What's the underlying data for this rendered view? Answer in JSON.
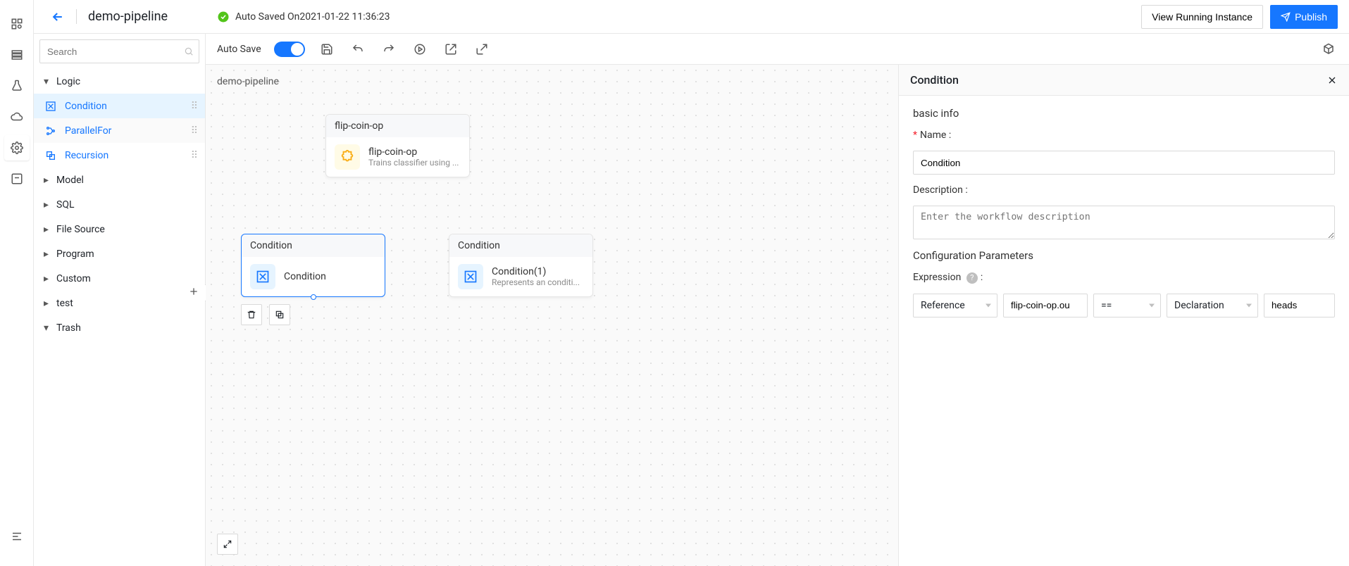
{
  "header": {
    "title": "demo-pipeline",
    "auto_saved_prefix": "Auto Saved On",
    "auto_saved_time": "2021-01-22 11:36:23",
    "btn_view_running": "View Running Instance",
    "btn_publish": "Publish"
  },
  "toolbar": {
    "auto_save_label": "Auto Save"
  },
  "palette": {
    "search_placeholder": "Search",
    "groups": {
      "logic": "Logic",
      "model": "Model",
      "sql": "SQL",
      "file_source": "File Source",
      "program": "Program",
      "custom": "Custom",
      "test": "test",
      "trash": "Trash"
    },
    "logic_items": {
      "condition": "Condition",
      "parallel_for": "ParallelFor",
      "recursion": "Recursion"
    }
  },
  "canvas": {
    "title": "demo-pipeline",
    "nodes": {
      "flip": {
        "head": "flip-coin-op",
        "title": "flip-coin-op",
        "sub": "Trains classifier using ..."
      },
      "cond1": {
        "head": "Condition",
        "title": "Condition"
      },
      "cond2": {
        "head": "Condition",
        "title": "Condition(1)",
        "sub": "Represents an conditi..."
      }
    }
  },
  "panel": {
    "title": "Condition",
    "section_basic": "basic info",
    "name_label": "Name",
    "name_value": "Condition",
    "desc_label": "Description",
    "desc_placeholder": "Enter the workflow description",
    "section_config": "Configuration Parameters",
    "expr_label": "Expression",
    "expr": {
      "ref_type": "Reference",
      "ref_value": "flip-coin-op.ou",
      "op": "==",
      "decl_type": "Declaration",
      "decl_value": "heads"
    }
  }
}
